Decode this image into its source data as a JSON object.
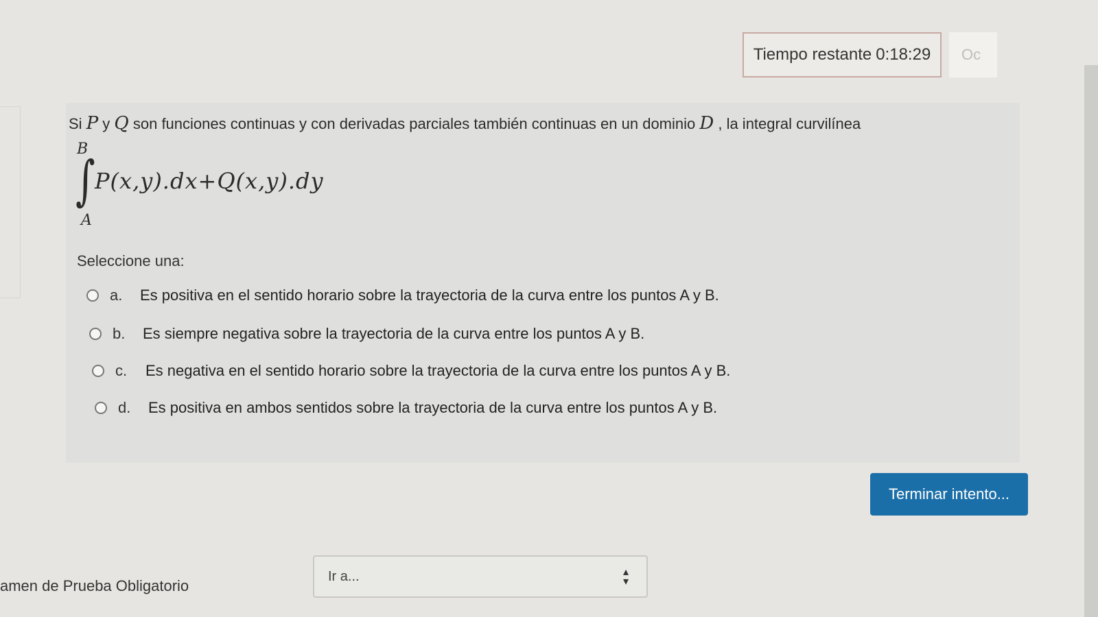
{
  "timer": {
    "label": "Tiempo restante",
    "value": "0:18:29"
  },
  "hide_label": "Oc",
  "question": {
    "intro_si": "Si ",
    "var_p": "P",
    "conj_y": " y ",
    "var_q": "Q",
    "text_mid": " son funciones continuas y con derivadas parciales también continuas en un dominio ",
    "var_d": "D",
    "text_end": " , la integral curvilínea",
    "integral_upper": "B",
    "integral_lower": "A",
    "integral_expr": "P(x,y).dx+Q(x,y).dy",
    "prompt": "Seleccione una:",
    "options": [
      {
        "letter": "a.",
        "text": "Es positiva en el sentido horario sobre la trayectoria de la curva entre los puntos A y B."
      },
      {
        "letter": "b.",
        "text": "Es siempre negativa sobre la trayectoria de la curva entre los puntos A y B."
      },
      {
        "letter": "c.",
        "text": "Es negativa en el sentido horario sobre la trayectoria de la curva entre los puntos A y B."
      },
      {
        "letter": "d.",
        "text": "Es positiva en ambos sentidos sobre la trayectoria de la curva entre los puntos A y B."
      }
    ]
  },
  "finish_button": "Terminar intento...",
  "footer": {
    "exam_title": "amen de Prueba Obligatorio",
    "jump_placeholder": "Ir a..."
  },
  "colors": {
    "accent": "#1b6fa8",
    "timer_border": "#c9a8a3"
  }
}
